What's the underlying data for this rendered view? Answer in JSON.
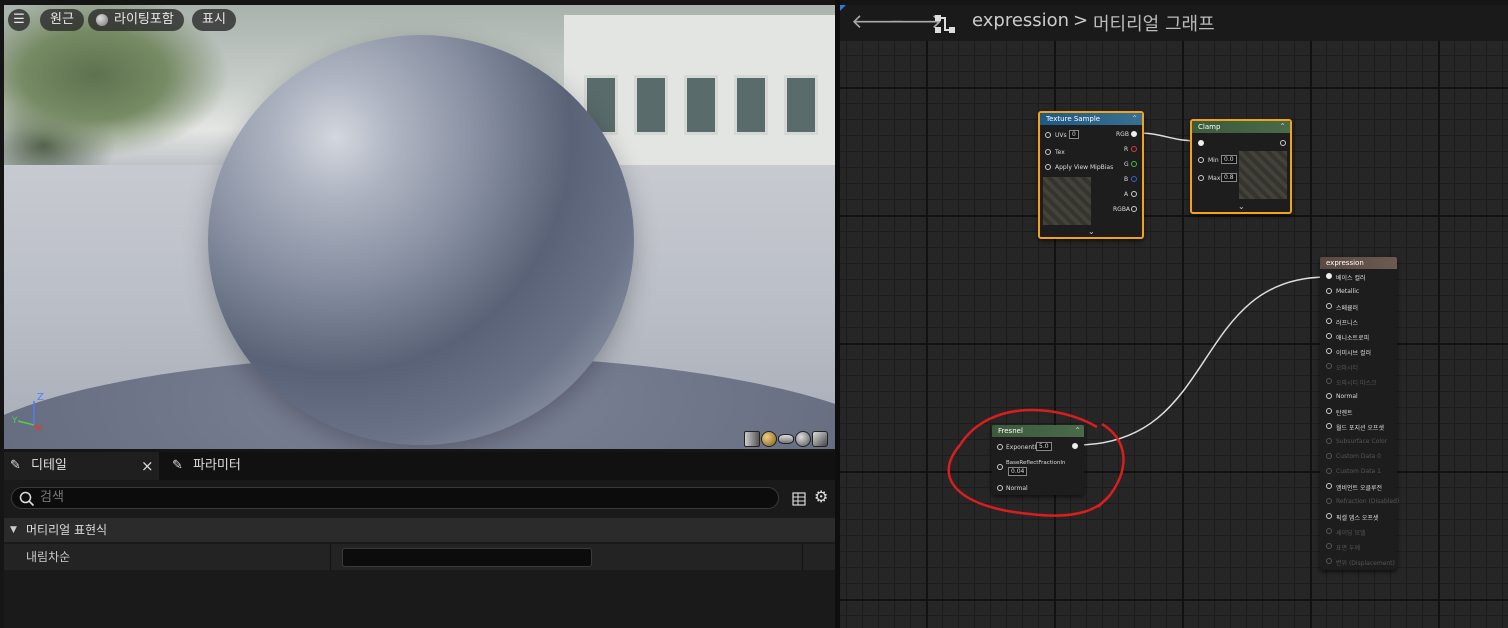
{
  "viewport": {
    "menu_icon": "hamburger-icon",
    "buttons": {
      "perspective": "원근",
      "lighting": "라이팅포함",
      "show": "표시"
    },
    "axis": {
      "z": "Z",
      "y": "Y",
      "x": "X"
    }
  },
  "details": {
    "tabs": [
      {
        "label": "디테일",
        "icon": "pencil-icon"
      },
      {
        "label": "파라미터",
        "icon": "pencil-icon"
      }
    ],
    "close_icon": "×",
    "search": {
      "placeholder": "검색",
      "value": ""
    },
    "section": {
      "label": "머티리얼 표현식"
    },
    "rows": [
      {
        "label": "내림차순",
        "value": ""
      }
    ]
  },
  "graph": {
    "breadcrumb": {
      "root": "expression",
      "separator": ">",
      "current": "머티리얼 그래프"
    },
    "nodes": {
      "texture_sample": {
        "title": "Texture Sample",
        "inputs": [
          "UVs",
          "Tex",
          "Apply View MipBias"
        ],
        "uvs_value": "0",
        "outputs": [
          "RGB",
          "R",
          "G",
          "B",
          "A",
          "RGBA"
        ],
        "colors": {
          "R": "#d93a3a",
          "G": "#3ac13a",
          "B": "#3a5fd9"
        }
      },
      "clamp": {
        "title": "Clamp",
        "inputs": [
          "Min",
          "Max"
        ],
        "min_value": "0.0",
        "max_value": "0.8"
      },
      "fresnel": {
        "title": "Fresnel",
        "inputs": [
          "ExponentIn",
          "BaseReflectFractionIn",
          "Normal"
        ],
        "exponent_value": "5.0",
        "base_reflect_value": "0.04"
      },
      "expression": {
        "title": "expression",
        "inputs": [
          {
            "label": "베이스 컬러",
            "enabled": true
          },
          {
            "label": "Metallic",
            "enabled": true
          },
          {
            "label": "스페큘러",
            "enabled": true
          },
          {
            "label": "러프니스",
            "enabled": true
          },
          {
            "label": "애니소트로피",
            "enabled": true
          },
          {
            "label": "이미시브 컬러",
            "enabled": true
          },
          {
            "label": "오파시티",
            "enabled": false
          },
          {
            "label": "오파시티 마스크",
            "enabled": false
          },
          {
            "label": "Normal",
            "enabled": true
          },
          {
            "label": "탄젠트",
            "enabled": true
          },
          {
            "label": "월드 포지션 오프셋",
            "enabled": true
          },
          {
            "label": "Subsurface Color",
            "enabled": false
          },
          {
            "label": "Custom Data 0",
            "enabled": false
          },
          {
            "label": "Custom Data 1",
            "enabled": false
          },
          {
            "label": "앰비언트 오클루전",
            "enabled": true
          },
          {
            "label": "Refraction (Disabled)",
            "enabled": false
          },
          {
            "label": "픽셀 뎁스 오프셋",
            "enabled": true
          },
          {
            "label": "셰이딩 모델",
            "enabled": false
          },
          {
            "label": "표면 두께",
            "enabled": false
          },
          {
            "label": "변위 (Displacement)",
            "enabled": false
          }
        ]
      }
    },
    "annotation_color": "#d81e1e"
  }
}
